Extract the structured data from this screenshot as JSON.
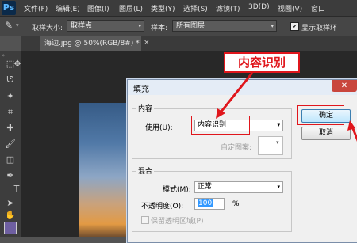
{
  "app": {
    "logo": "Ps"
  },
  "menu": [
    "文件(F)",
    "编辑(E)",
    "图像(I)",
    "图层(L)",
    "类型(Y)",
    "选择(S)",
    "滤镜(T)",
    "3D(D)",
    "视图(V)",
    "窗口"
  ],
  "options_bar": {
    "sample_size_label": "取样大小:",
    "sample_size_value": "取样点",
    "sample_label": "样本:",
    "sample_value": "所有图层",
    "show_ring_label": "显示取样环",
    "show_ring_checked": true
  },
  "document_tab": {
    "label": "海边.jpg @ 50%(RGB/8#) *",
    "close": "×"
  },
  "annotation": {
    "label": "内容识别"
  },
  "dialog": {
    "title": "填充",
    "close": "✕",
    "content_group": {
      "label": "内容",
      "use_label": "使用(U):",
      "use_value": "内容识别",
      "custom_pattern_label": "自定图案:"
    },
    "blend_group": {
      "label": "混合",
      "mode_label": "模式(M):",
      "mode_value": "正常",
      "opacity_label": "不透明度(O):",
      "opacity_value": "100",
      "opacity_unit": "%",
      "preserve_transparency_label": "保留透明区域(P)",
      "preserve_transparency_checked": false
    },
    "ok_label": "确定",
    "cancel_label": "取消"
  },
  "colors": {
    "annotation_red": "#e0161c",
    "foreground_swatch": "#6e5fa1"
  }
}
